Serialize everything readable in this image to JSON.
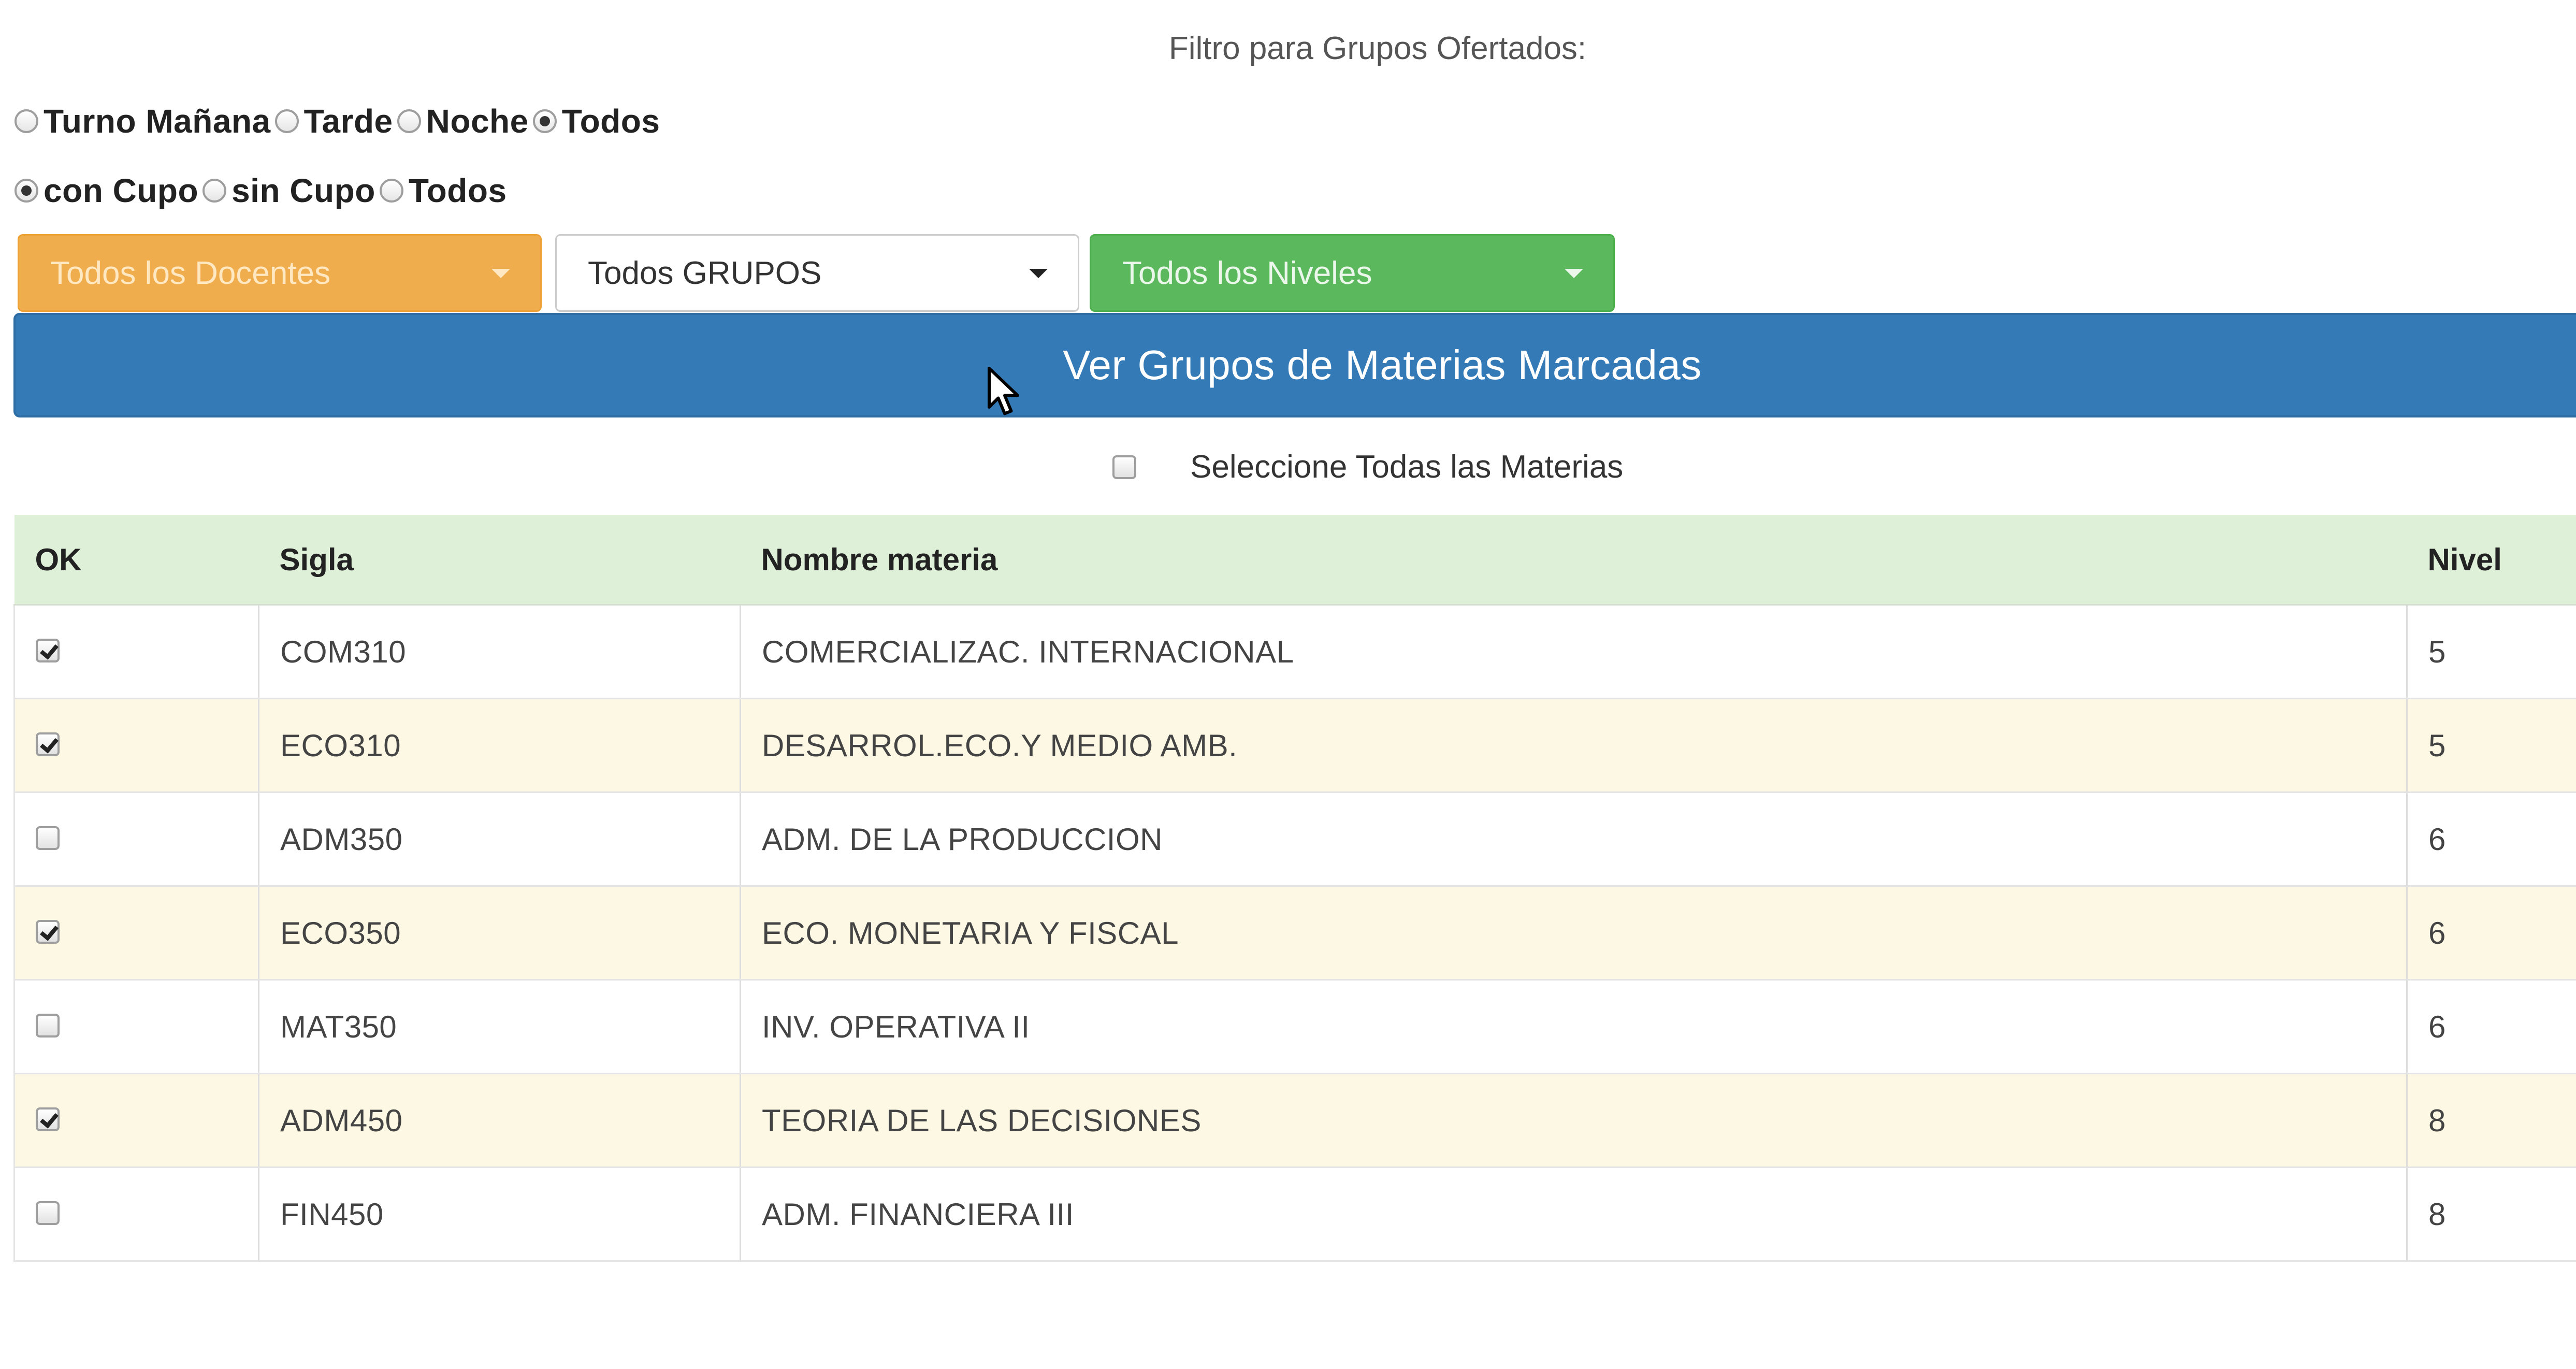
{
  "filter": {
    "title": "Filtro para Grupos Ofertados:",
    "turno_options": [
      {
        "label": "Turno Mañana",
        "checked": false
      },
      {
        "label": "Tarde",
        "checked": false
      },
      {
        "label": "Noche",
        "checked": false
      },
      {
        "label": "Todos",
        "checked": true
      }
    ],
    "cupo_options": [
      {
        "label": "con Cupo",
        "checked": true
      },
      {
        "label": "sin Cupo",
        "checked": false
      },
      {
        "label": "Todos",
        "checked": false
      }
    ]
  },
  "dropdowns": {
    "docentes": "Todos los Docentes",
    "grupos": "Todos GRUPOS",
    "niveles": "Todos los Niveles"
  },
  "colors": {
    "docentes": "#f0ad4e",
    "niveles": "#5cb85c",
    "primary": "#337ab7",
    "table_header": "#dff0d8",
    "row_alt": "#fcf8e3"
  },
  "main_button": "Ver Grupos de Materias Marcadas",
  "select_all": {
    "label": "Seleccione Todas las Materias",
    "checked": false
  },
  "table": {
    "headers": {
      "ok": "OK",
      "sigla": "Sigla",
      "nombre": "Nombre materia",
      "nivel": "Nivel"
    },
    "rows": [
      {
        "ok": true,
        "sigla": "COM310",
        "nombre": "COMERCIALIZAC. INTERNACIONAL",
        "nivel": "5"
      },
      {
        "ok": true,
        "sigla": "ECO310",
        "nombre": "DESARROL.ECO.Y MEDIO AMB.",
        "nivel": "5"
      },
      {
        "ok": false,
        "sigla": "ADM350",
        "nombre": "ADM. DE LA PRODUCCION",
        "nivel": "6"
      },
      {
        "ok": true,
        "sigla": "ECO350",
        "nombre": "ECO. MONETARIA Y FISCAL",
        "nivel": "6"
      },
      {
        "ok": false,
        "sigla": "MAT350",
        "nombre": "INV. OPERATIVA II",
        "nivel": "6"
      },
      {
        "ok": true,
        "sigla": "ADM450",
        "nombre": "TEORIA DE LAS DECISIONES",
        "nivel": "8"
      },
      {
        "ok": false,
        "sigla": "FIN450",
        "nombre": "ADM. FINANCIERA III",
        "nivel": "8"
      }
    ]
  }
}
